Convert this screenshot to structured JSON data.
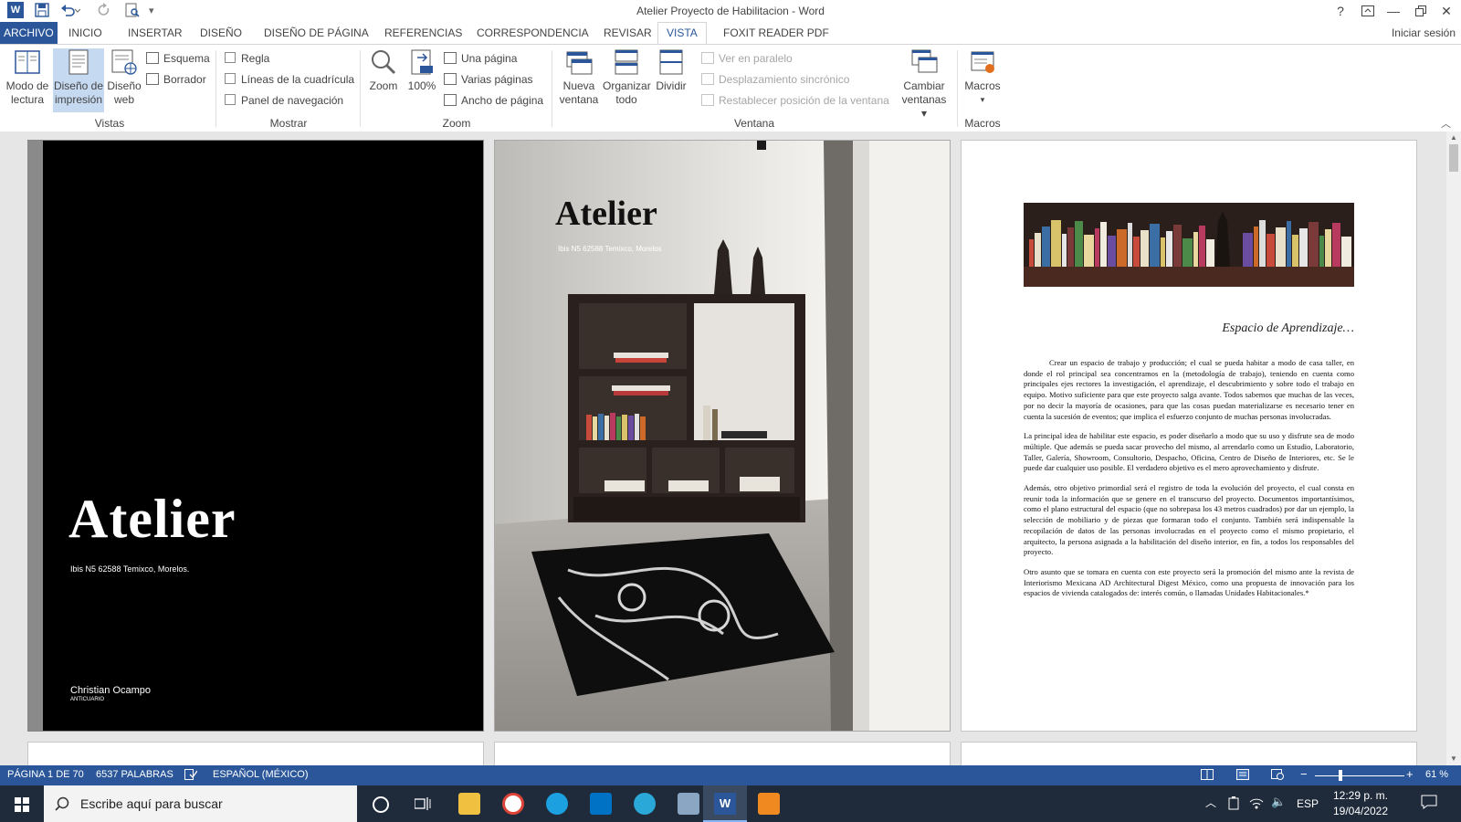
{
  "window": {
    "title": "Atelier Proyecto de Habilitacion - Word",
    "help": "?",
    "signin": "Iniciar sesión"
  },
  "tabs": {
    "file": "ARCHIVO",
    "items": [
      "INICIO",
      "INSERTAR",
      "DISEÑO",
      "DISEÑO DE PÁGINA",
      "REFERENCIAS",
      "CORRESPONDENCIA",
      "REVISAR",
      "VISTA",
      "FOXIT READER PDF"
    ],
    "active": "VISTA"
  },
  "ribbon": {
    "vistas": {
      "label": "Vistas",
      "lectura": [
        "Modo de",
        "lectura"
      ],
      "impresion": [
        "Diseño de",
        "impresión"
      ],
      "web": [
        "Diseño",
        "web"
      ],
      "esquema": "Esquema",
      "borrador": "Borrador"
    },
    "mostrar": {
      "label": "Mostrar",
      "regla": "Regla",
      "lineas": "Líneas de la cuadrícula",
      "panel": "Panel de navegación"
    },
    "zoom": {
      "label": "Zoom",
      "zoom": "Zoom",
      "cien": "100%",
      "una": "Una página",
      "varias": "Varias páginas",
      "ancho": "Ancho de página"
    },
    "ventana": {
      "label": "Ventana",
      "nueva": [
        "Nueva",
        "ventana"
      ],
      "organizar": [
        "Organizar",
        "todo"
      ],
      "dividir": "Dividir",
      "paralelo": "Ver en paralelo",
      "desplazamiento": "Desplazamiento sincrónico",
      "restablecer": "Restablecer posición de la ventana",
      "cambiar": [
        "Cambiar",
        "ventanas ▾"
      ]
    },
    "macros": {
      "label": "Macros",
      "macros": "Macros"
    }
  },
  "pages": {
    "cover": {
      "title": "Atelier",
      "address": "Ibis N5 62588 Temixco, Morelos.",
      "author": "Christian Ocampo",
      "role": "ANTICUARIO"
    },
    "photo": {
      "title": "Atelier",
      "address": "Ibis N5 62588 Temixco, Morelos"
    },
    "text": {
      "heading": "Espacio de Aprendizaje…",
      "paragraphs": [
        "Crear un espacio de trabajo y producción; el cual se pueda habitar a modo de casa taller, en donde el rol principal sea concentramos en la (metodología de trabajo), teniendo en cuenta como principales ejes rectores la investigación, el aprendizaje, el descubrimiento y sobre todo el trabajo en equipo. Motivo suficiente para que este proyecto salga avante. Todos sabemos que muchas de las veces, por no decir la mayoría de ocasiones, para que las cosas puedan materializarse es necesario tener en cuenta la sucesión de eventos; que implica el esfuerzo conjunto de muchas personas involucradas.",
        "La principal idea de habilitar este espacio, es poder diseñarlo a modo que su uso y disfrute sea de modo múltiple. Que además se pueda sacar provecho del mismo, al arrendarlo como un Estudio, Laboratorio, Taller, Galería, Showroom, Consultorio, Despacho, Oficina, Centro de Diseño de Interiores, etc. Se le puede dar cualquier uso posible. El verdadero objetivo es el mero aprovechamiento y disfrute.",
        "Además, otro objetivo primordial será el registro de toda la evolución del proyecto, el cual consta en reunir toda la información que se genere en el transcurso del proyecto. Documentos importantísimos, como el plano estructural del espacio (que no sobrepasa los 43 metros cuadrados) por dar un ejemplo, la selección de mobiliario y de piezas que formaran todo el conjunto. También será indispensable la recopilación de datos de las personas involucradas en el proyecto como el mismo propietario, el arquitecto, la persona asignada a la habilitación del diseño interior, en fin, a todos los responsables del proyecto.",
        "Otro asunto que se tomara en cuenta con este proyecto será la promoción del mismo ante la revista de Interiorismo Mexicana AD Architectural Digest México, como una propuesta de innovación para los espacios de vivienda catalogados de: interés común, o llamadas Unidades Habitacionales.*"
      ]
    }
  },
  "status": {
    "page": "PÁGINA 1 DE 70",
    "words": "6537 PALABRAS",
    "language": "ESPAÑOL (MÉXICO)",
    "zoom": "61 %",
    "zoom_level": 61
  },
  "taskbar": {
    "search_placeholder": "Escribe aquí para buscar",
    "lang": "ESP",
    "time": "12:29 p. m.",
    "date": "19/04/2022"
  },
  "colors": {
    "word_blue": "#2b579a",
    "selected": "#c5d9f1"
  }
}
